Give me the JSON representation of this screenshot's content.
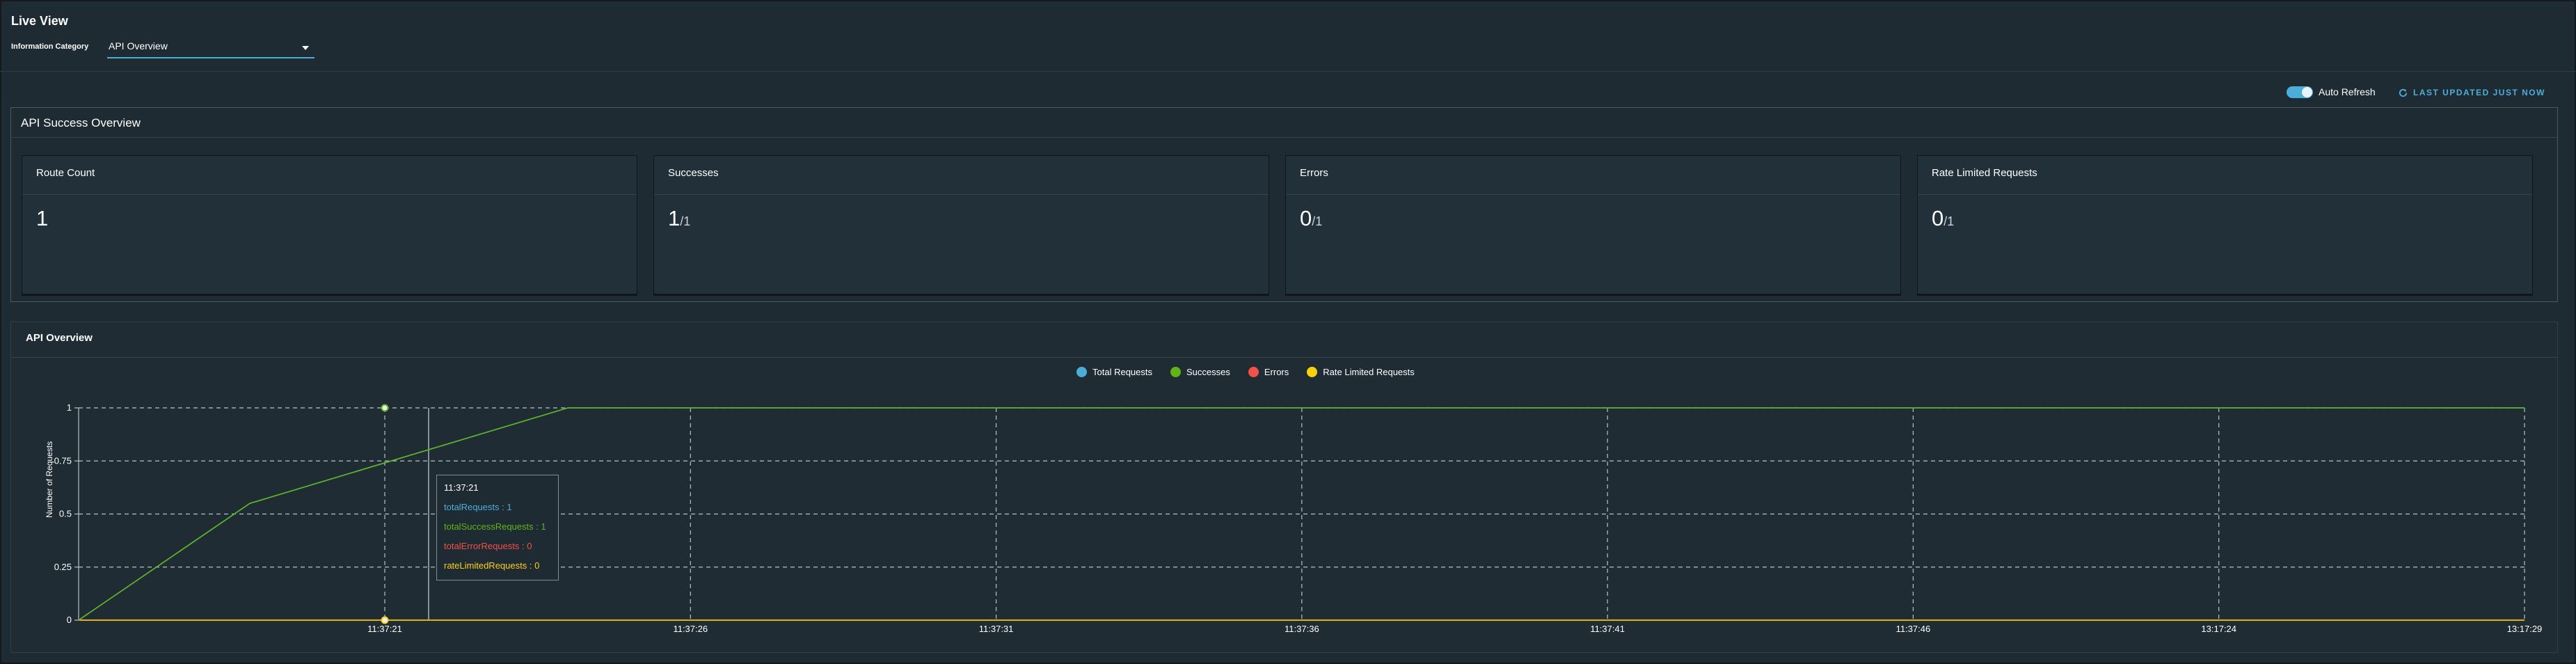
{
  "page": {
    "title": "Live View"
  },
  "filter": {
    "label": "Information Category",
    "selected": "API Overview"
  },
  "refresh": {
    "auto_refresh_label": "Auto Refresh",
    "auto_refresh_on": true,
    "last_updated_label": "LAST UPDATED JUST NOW"
  },
  "success_overview": {
    "title": "API Success Overview",
    "cards": [
      {
        "title": "Route Count",
        "value": "1",
        "denominator": ""
      },
      {
        "title": "Successes",
        "value": "1",
        "denominator": "/1"
      },
      {
        "title": "Errors",
        "value": "0",
        "denominator": "/1"
      },
      {
        "title": "Rate Limited Requests",
        "value": "0",
        "denominator": "/1"
      }
    ]
  },
  "api_overview": {
    "title": "API Overview",
    "tooltip": {
      "time": "11:37:21",
      "lines": [
        {
          "text": "totalRequests : 1",
          "color": "#49afd9"
        },
        {
          "text": "totalSuccessRequests : 1",
          "color": "#60b515"
        },
        {
          "text": "totalErrorRequests : 0",
          "color": "#f54f47"
        },
        {
          "text": "rateLimitedRequests : 0",
          "color": "#fdd008"
        }
      ]
    }
  },
  "chart_data": {
    "type": "line",
    "ylabel": "Number of Requests",
    "ylim": [
      0,
      1
    ],
    "y_ticks": [
      "0",
      "0.25",
      "0.5",
      "0.75",
      "1"
    ],
    "x_ticks": [
      "11:37:21",
      "11:37:26",
      "11:37:31",
      "11:37:36",
      "11:37:41",
      "11:37:46",
      "13:17:24",
      "13:17:29"
    ],
    "grid": true,
    "legend_position": "top-center",
    "series": [
      {
        "name": "Total Requests",
        "color": "#49afd9",
        "x": [
          0,
          0.07,
          0.2,
          1
        ],
        "values": [
          0,
          0.55,
          1,
          1
        ]
      },
      {
        "name": "Successes",
        "color": "#60b515",
        "x": [
          0,
          0.07,
          0.2,
          1
        ],
        "values": [
          0,
          0.55,
          1,
          1
        ]
      },
      {
        "name": "Errors",
        "color": "#f54f47",
        "x": [
          0,
          1
        ],
        "values": [
          0,
          0
        ]
      },
      {
        "name": "Rate Limited Requests",
        "color": "#fdd008",
        "x": [
          0,
          1
        ],
        "values": [
          0,
          0
        ]
      }
    ]
  }
}
